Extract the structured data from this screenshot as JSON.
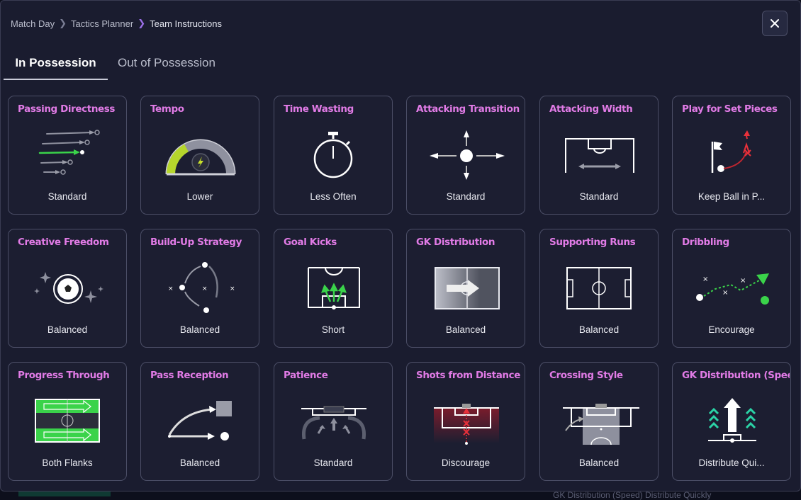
{
  "breadcrumb": {
    "items": [
      "Match Day",
      "Tactics Planner",
      "Team Instructions"
    ]
  },
  "close_button": {
    "icon": "close-icon"
  },
  "tabs": [
    {
      "label": "In Possession",
      "active": true
    },
    {
      "label": "Out of Possession",
      "active": false
    }
  ],
  "cards": [
    {
      "title": "Passing Directness",
      "value": "Standard",
      "icon": "passing-directness-icon"
    },
    {
      "title": "Tempo",
      "value": "Lower",
      "icon": "tempo-gauge-icon"
    },
    {
      "title": "Time Wasting",
      "value": "Less Often",
      "icon": "stopwatch-icon"
    },
    {
      "title": "Attacking Transition",
      "value": "Standard",
      "icon": "transition-arrows-icon"
    },
    {
      "title": "Attacking Width",
      "value": "Standard",
      "icon": "pitch-width-icon"
    },
    {
      "title": "Play for Set Pieces",
      "value": "Keep Ball in P...",
      "icon": "corner-flag-icon"
    },
    {
      "title": "Creative Freedom",
      "value": "Balanced",
      "icon": "ball-sparkle-icon"
    },
    {
      "title": "Build-Up Strategy",
      "value": "Balanced",
      "icon": "build-up-icon"
    },
    {
      "title": "Goal Kicks",
      "value": "Short",
      "icon": "goal-kick-icon"
    },
    {
      "title": "GK Distribution",
      "value": "Balanced",
      "icon": "gk-distribution-icon"
    },
    {
      "title": "Supporting Runs",
      "value": "Balanced",
      "icon": "pitch-icon"
    },
    {
      "title": "Dribbling",
      "value": "Encourage",
      "icon": "dribbling-icon"
    },
    {
      "title": "Progress Through",
      "value": "Both Flanks",
      "icon": "flanks-pitch-icon"
    },
    {
      "title": "Pass Reception",
      "value": "Balanced",
      "icon": "pass-reception-icon"
    },
    {
      "title": "Patience",
      "value": "Standard",
      "icon": "patience-icon"
    },
    {
      "title": "Shots from Distance",
      "value": "Discourage",
      "icon": "shots-distance-icon"
    },
    {
      "title": "Crossing Style",
      "value": "Balanced",
      "icon": "crossing-icon"
    },
    {
      "title": "GK Distribution (Speed",
      "value": "Distribute Qui...",
      "icon": "speed-arrows-icon"
    }
  ],
  "background_text": "GK Distribution (Speed)  Distribute Quickly",
  "colors": {
    "accent_title": "#e17be6",
    "positive": "#3ad34a",
    "negative": "#e8303a",
    "teal": "#2bd3a6"
  }
}
